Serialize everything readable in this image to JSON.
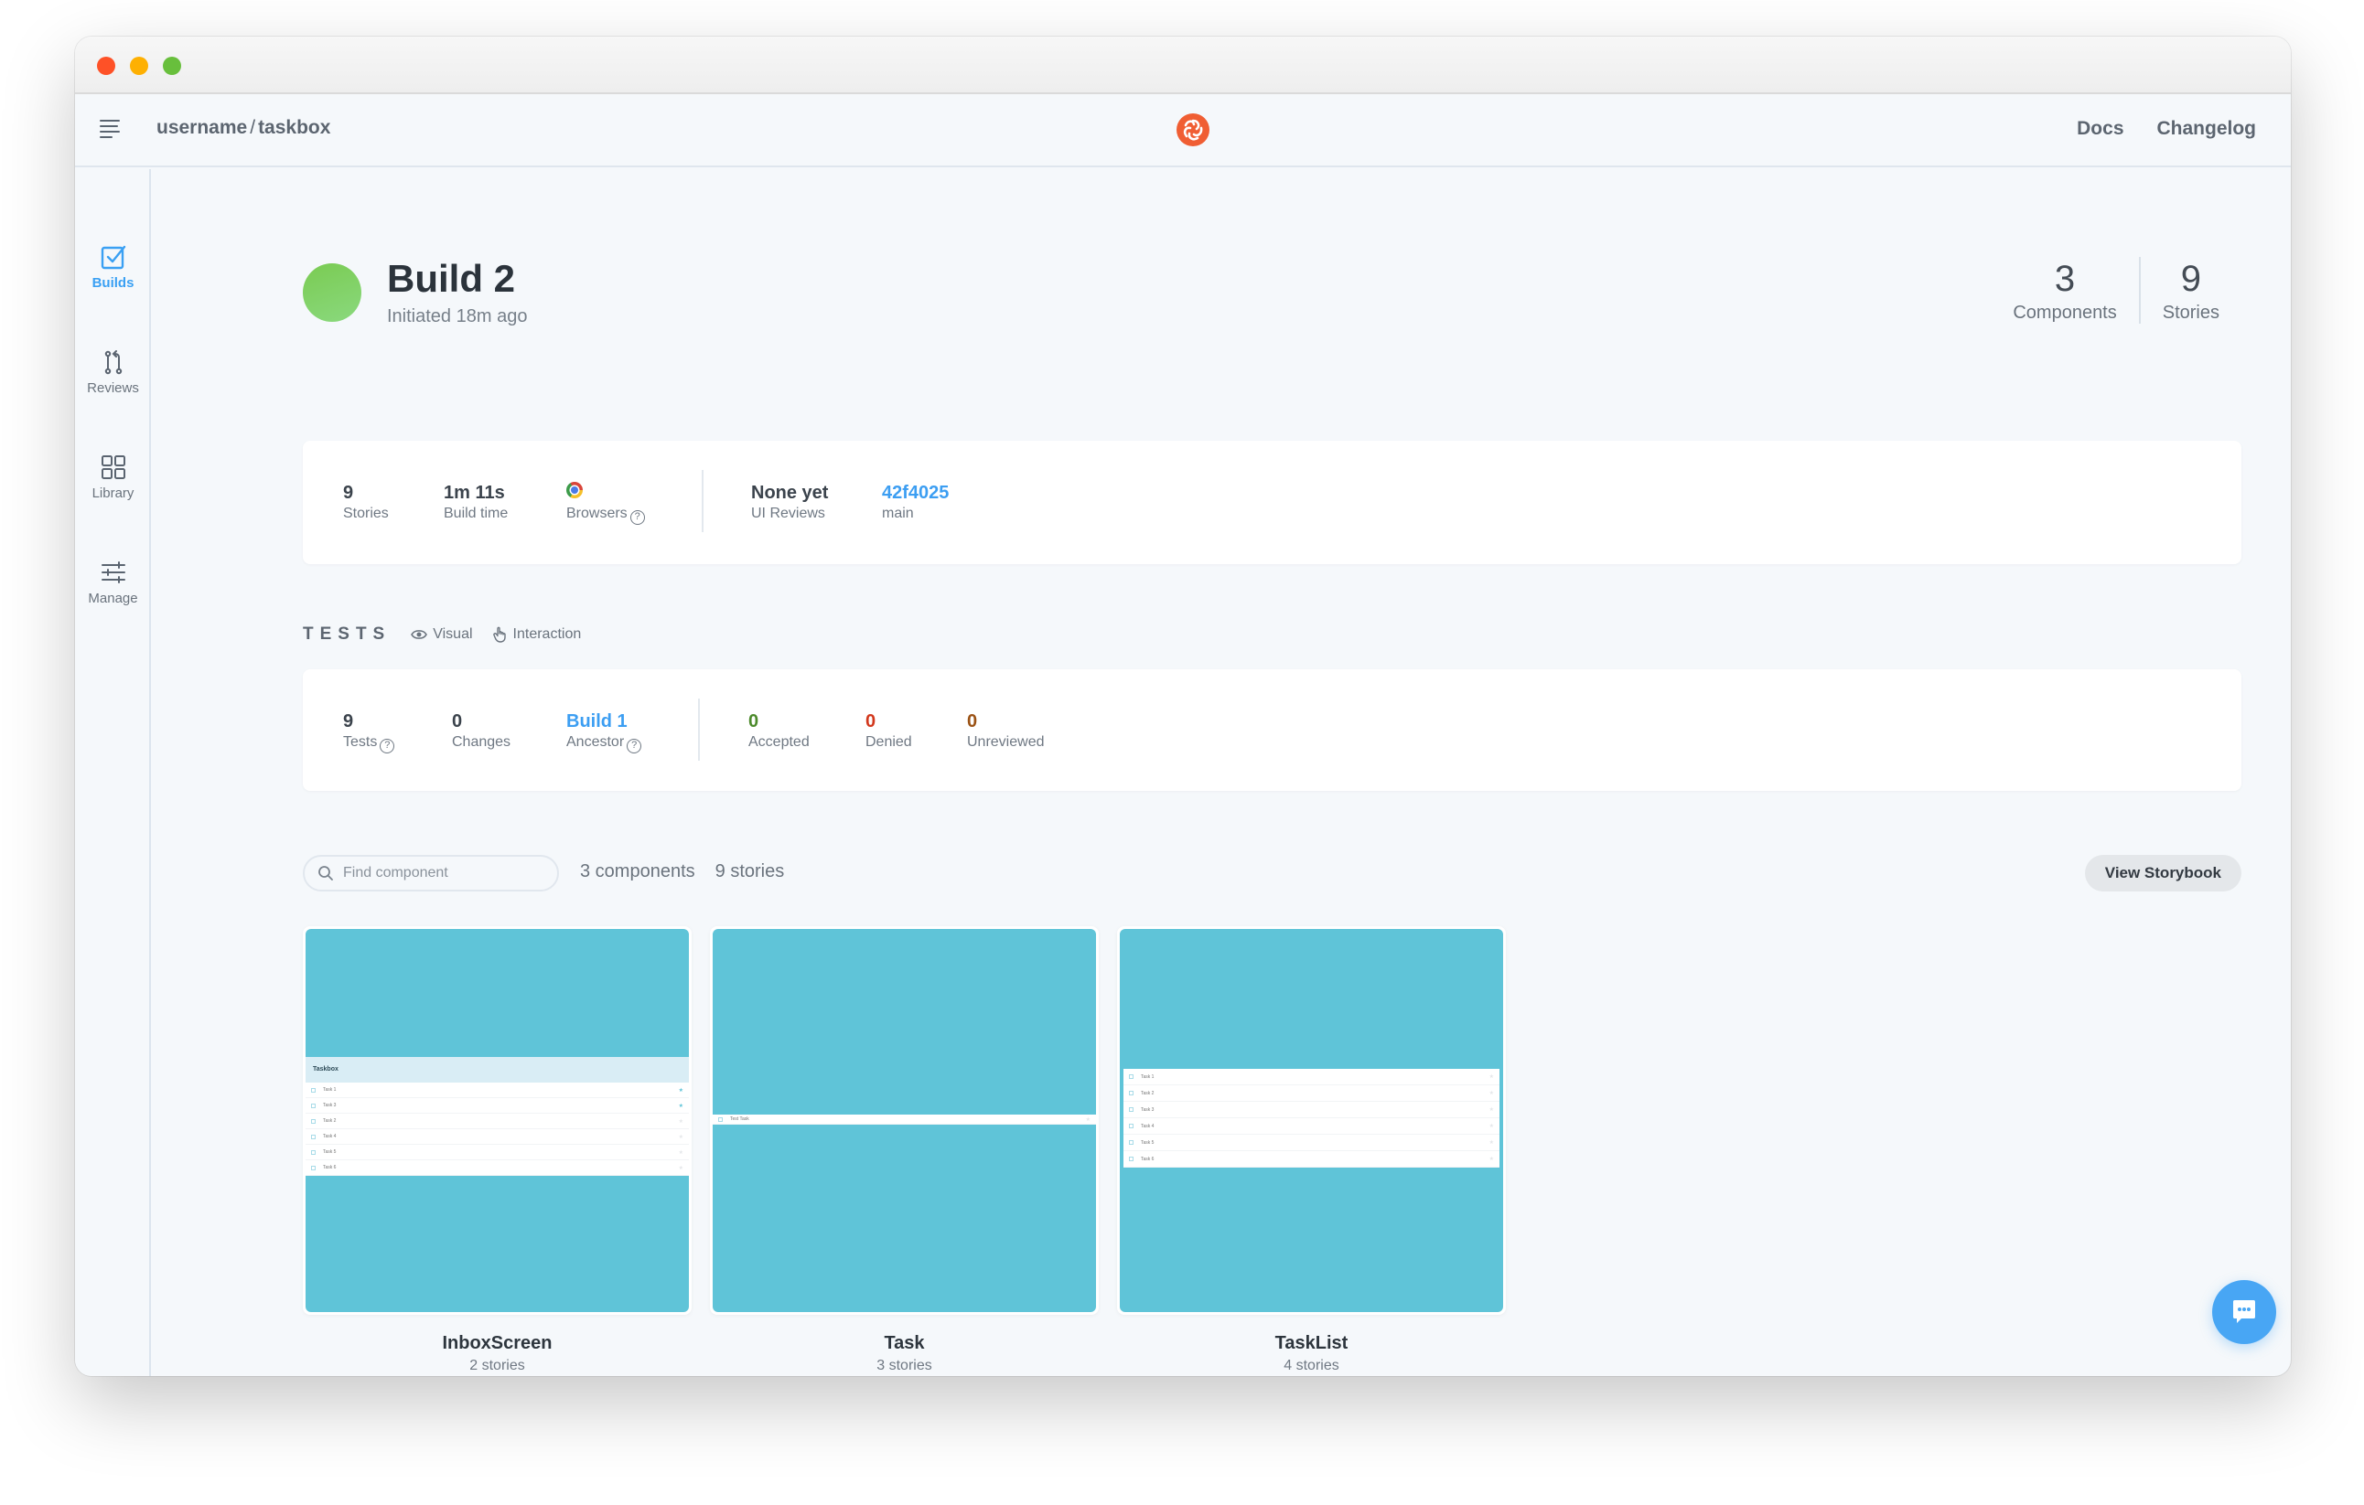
{
  "header": {
    "breadcrumb_owner": "username",
    "breadcrumb_separator": "/",
    "breadcrumb_repo": "taskbox",
    "nav": [
      {
        "label": "Docs"
      },
      {
        "label": "Changelog"
      }
    ]
  },
  "sidebar": {
    "items": [
      {
        "label": "Builds",
        "icon": "checkbox-icon",
        "active": true
      },
      {
        "label": "Reviews",
        "icon": "pull-request-icon",
        "active": false
      },
      {
        "label": "Library",
        "icon": "grid-icon",
        "active": false
      },
      {
        "label": "Manage",
        "icon": "sliders-icon",
        "active": false
      }
    ]
  },
  "build": {
    "title": "Build 2",
    "subtitle": "Initiated 18m ago",
    "status_color": "#7acb52",
    "summary": [
      {
        "value": "3",
        "label": "Components"
      },
      {
        "value": "9",
        "label": "Stories"
      }
    ]
  },
  "info": {
    "stories": {
      "value": "9",
      "label": "Stories"
    },
    "build_time": {
      "value": "1m 11s",
      "label": "Build time"
    },
    "browsers": {
      "label": "Browsers",
      "icon": "chrome-icon"
    },
    "ui_reviews": {
      "value": "None yet",
      "label": "UI Reviews"
    },
    "commit": {
      "value": "42f4025",
      "label": "main"
    }
  },
  "tests": {
    "title": "TESTS",
    "tabs": [
      {
        "label": "Visual",
        "icon": "eye-icon"
      },
      {
        "label": "Interaction",
        "icon": "pointer-hand-icon"
      }
    ],
    "tests": {
      "value": "9",
      "label": "Tests"
    },
    "changes": {
      "value": "0",
      "label": "Changes"
    },
    "ancestor": {
      "value": "Build 1",
      "label": "Ancestor"
    },
    "accepted": {
      "value": "0",
      "label": "Accepted"
    },
    "denied": {
      "value": "0",
      "label": "Denied"
    },
    "unreviewed": {
      "value": "0",
      "label": "Unreviewed"
    }
  },
  "library": {
    "search_placeholder": "Find component",
    "components_count": "3 components",
    "stories_count": "9 stories",
    "view_storybook": "View Storybook",
    "components": [
      {
        "name": "InboxScreen",
        "stories": "2 stories"
      },
      {
        "name": "Task",
        "stories": "3 stories"
      },
      {
        "name": "TaskList",
        "stories": "4 stories"
      }
    ],
    "inbox_preview": {
      "heading": "Taskbox",
      "tasks": [
        {
          "title": "Task 1",
          "pinned": true
        },
        {
          "title": "Task 3",
          "pinned": true
        },
        {
          "title": "Task 2",
          "pinned": false
        },
        {
          "title": "Task 4",
          "pinned": false
        },
        {
          "title": "Task 5",
          "pinned": false
        },
        {
          "title": "Task 6",
          "pinned": false
        }
      ]
    },
    "task_preview": {
      "title": "Test Task"
    },
    "tasklist_preview": {
      "tasks": [
        {
          "title": "Task 1"
        },
        {
          "title": "Task 2"
        },
        {
          "title": "Task 3"
        },
        {
          "title": "Task 4"
        },
        {
          "title": "Task 5"
        },
        {
          "title": "Task 6"
        }
      ]
    }
  },
  "colors": {
    "accent": "#3c9ef2",
    "brand": "#f05e33",
    "preview_bg": "#5fc4d8",
    "accepted": "#4c8a2b",
    "denied": "#d2371c",
    "unreviewed": "#9b5214"
  }
}
